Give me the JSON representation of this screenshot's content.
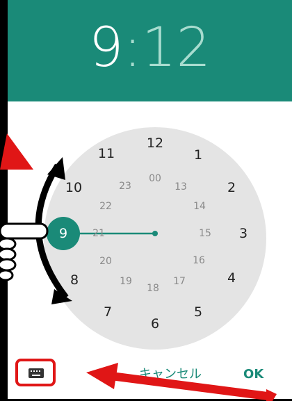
{
  "header": {
    "hour": "9",
    "separator": ":",
    "minute": "12"
  },
  "dial": {
    "outer_labels": [
      "12",
      "1",
      "2",
      "3",
      "4",
      "5",
      "6",
      "7",
      "8",
      "9",
      "10",
      "11"
    ],
    "inner_labels": [
      "00",
      "13",
      "14",
      "15",
      "16",
      "17",
      "18",
      "19",
      "20",
      "21",
      "22",
      "23"
    ],
    "selected_label": "9"
  },
  "footer": {
    "keyboard_icon": "keyboard-icon",
    "cancel_label": "キャンセル",
    "ok_label": "OK"
  },
  "colors": {
    "accent": "#1a8a78",
    "minute_light": "#a8dccf",
    "dial_bg": "#e4e4e4",
    "annotation_red": "#e01616"
  }
}
